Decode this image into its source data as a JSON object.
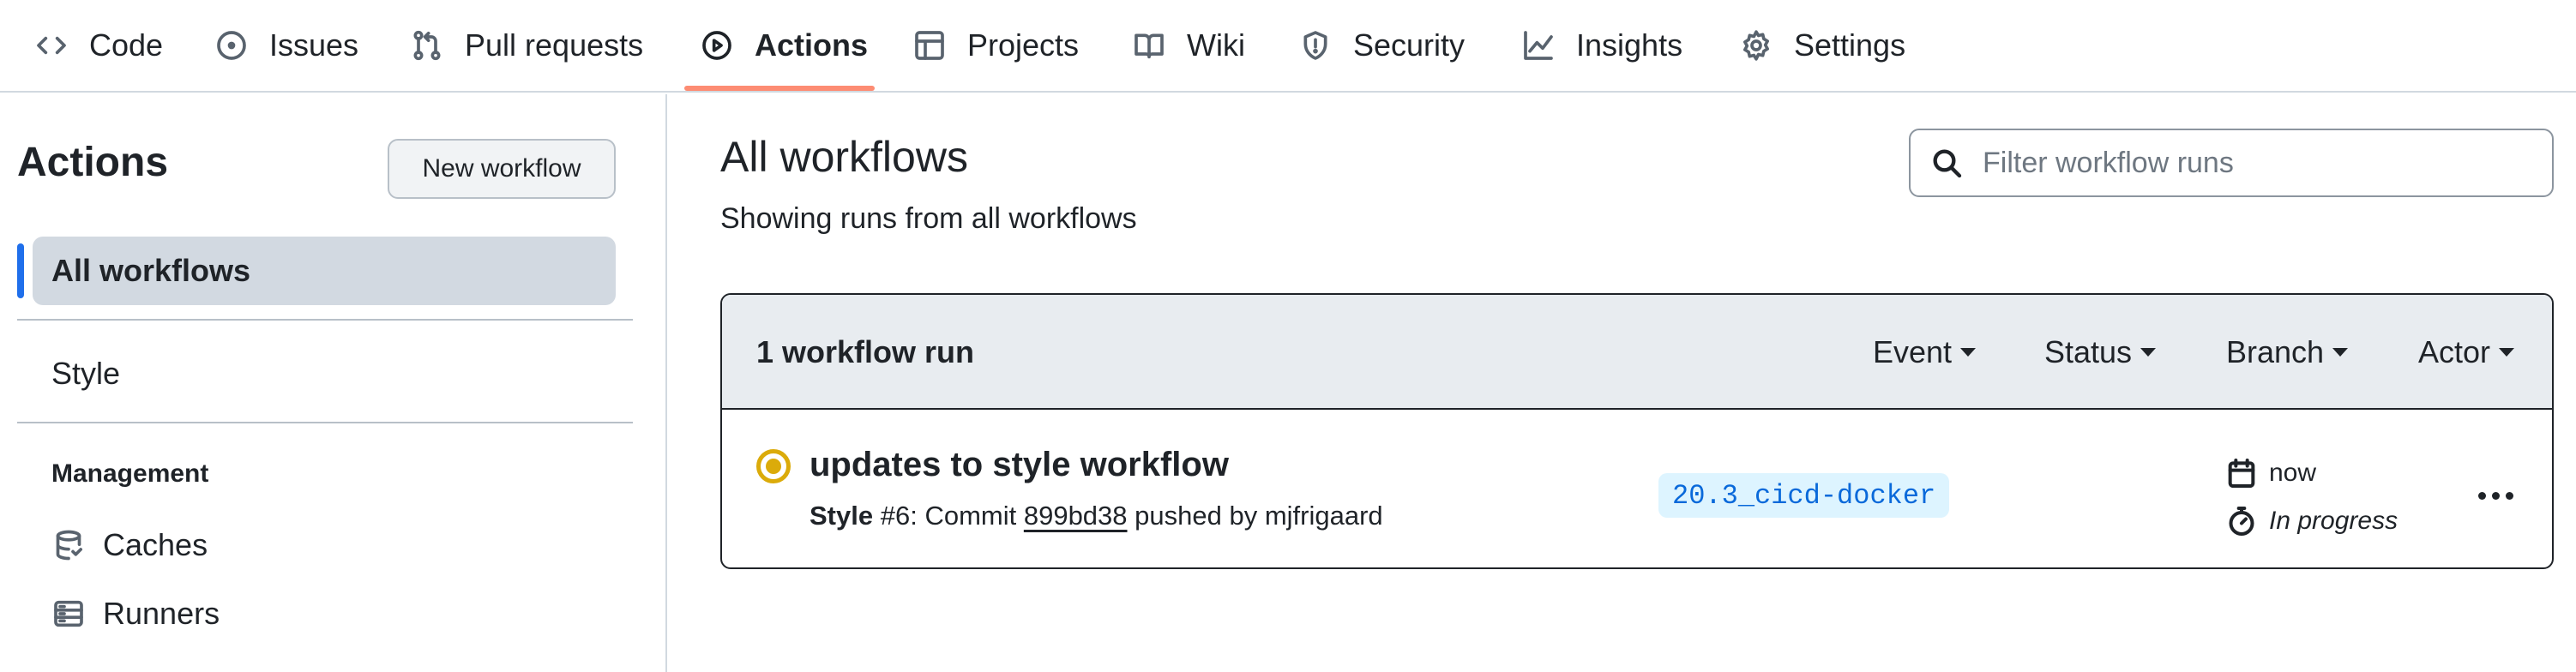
{
  "nav": {
    "tabs": [
      {
        "label": "Code",
        "icon": "code-icon"
      },
      {
        "label": "Issues",
        "icon": "issue-opened-icon"
      },
      {
        "label": "Pull requests",
        "icon": "git-pull-request-icon"
      },
      {
        "label": "Actions",
        "icon": "play-icon",
        "active": true
      },
      {
        "label": "Projects",
        "icon": "table-icon"
      },
      {
        "label": "Wiki",
        "icon": "book-icon"
      },
      {
        "label": "Security",
        "icon": "shield-icon"
      },
      {
        "label": "Insights",
        "icon": "graph-icon"
      },
      {
        "label": "Settings",
        "icon": "gear-icon"
      }
    ],
    "active_underline_color": "#fd8c73"
  },
  "sidebar": {
    "title": "Actions",
    "new_workflow_label": "New workflow",
    "selected_item": "All workflows",
    "workflows": [
      "Style"
    ],
    "management_heading": "Management",
    "management_items": [
      {
        "label": "Caches",
        "icon": "database-icon"
      },
      {
        "label": "Runners",
        "icon": "server-icon"
      }
    ],
    "accent_color": "#1f6feb"
  },
  "main": {
    "title": "All workflows",
    "subtitle": "Showing runs from all workflows",
    "filter_placeholder": "Filter workflow runs",
    "runs_count_label": "1 workflow run",
    "filters": [
      "Event",
      "Status",
      "Branch",
      "Actor"
    ],
    "runs": [
      {
        "status": "in-progress",
        "status_color": "#dbab0a",
        "title": "updates to style workflow",
        "workflow": "Style",
        "meta_run": "#6: Commit",
        "commit_sha": "899bd38",
        "meta_pushed": "pushed by mjfrigaard",
        "branch": "20.3_cicd-docker",
        "when": "now",
        "duration": "In progress"
      }
    ]
  }
}
